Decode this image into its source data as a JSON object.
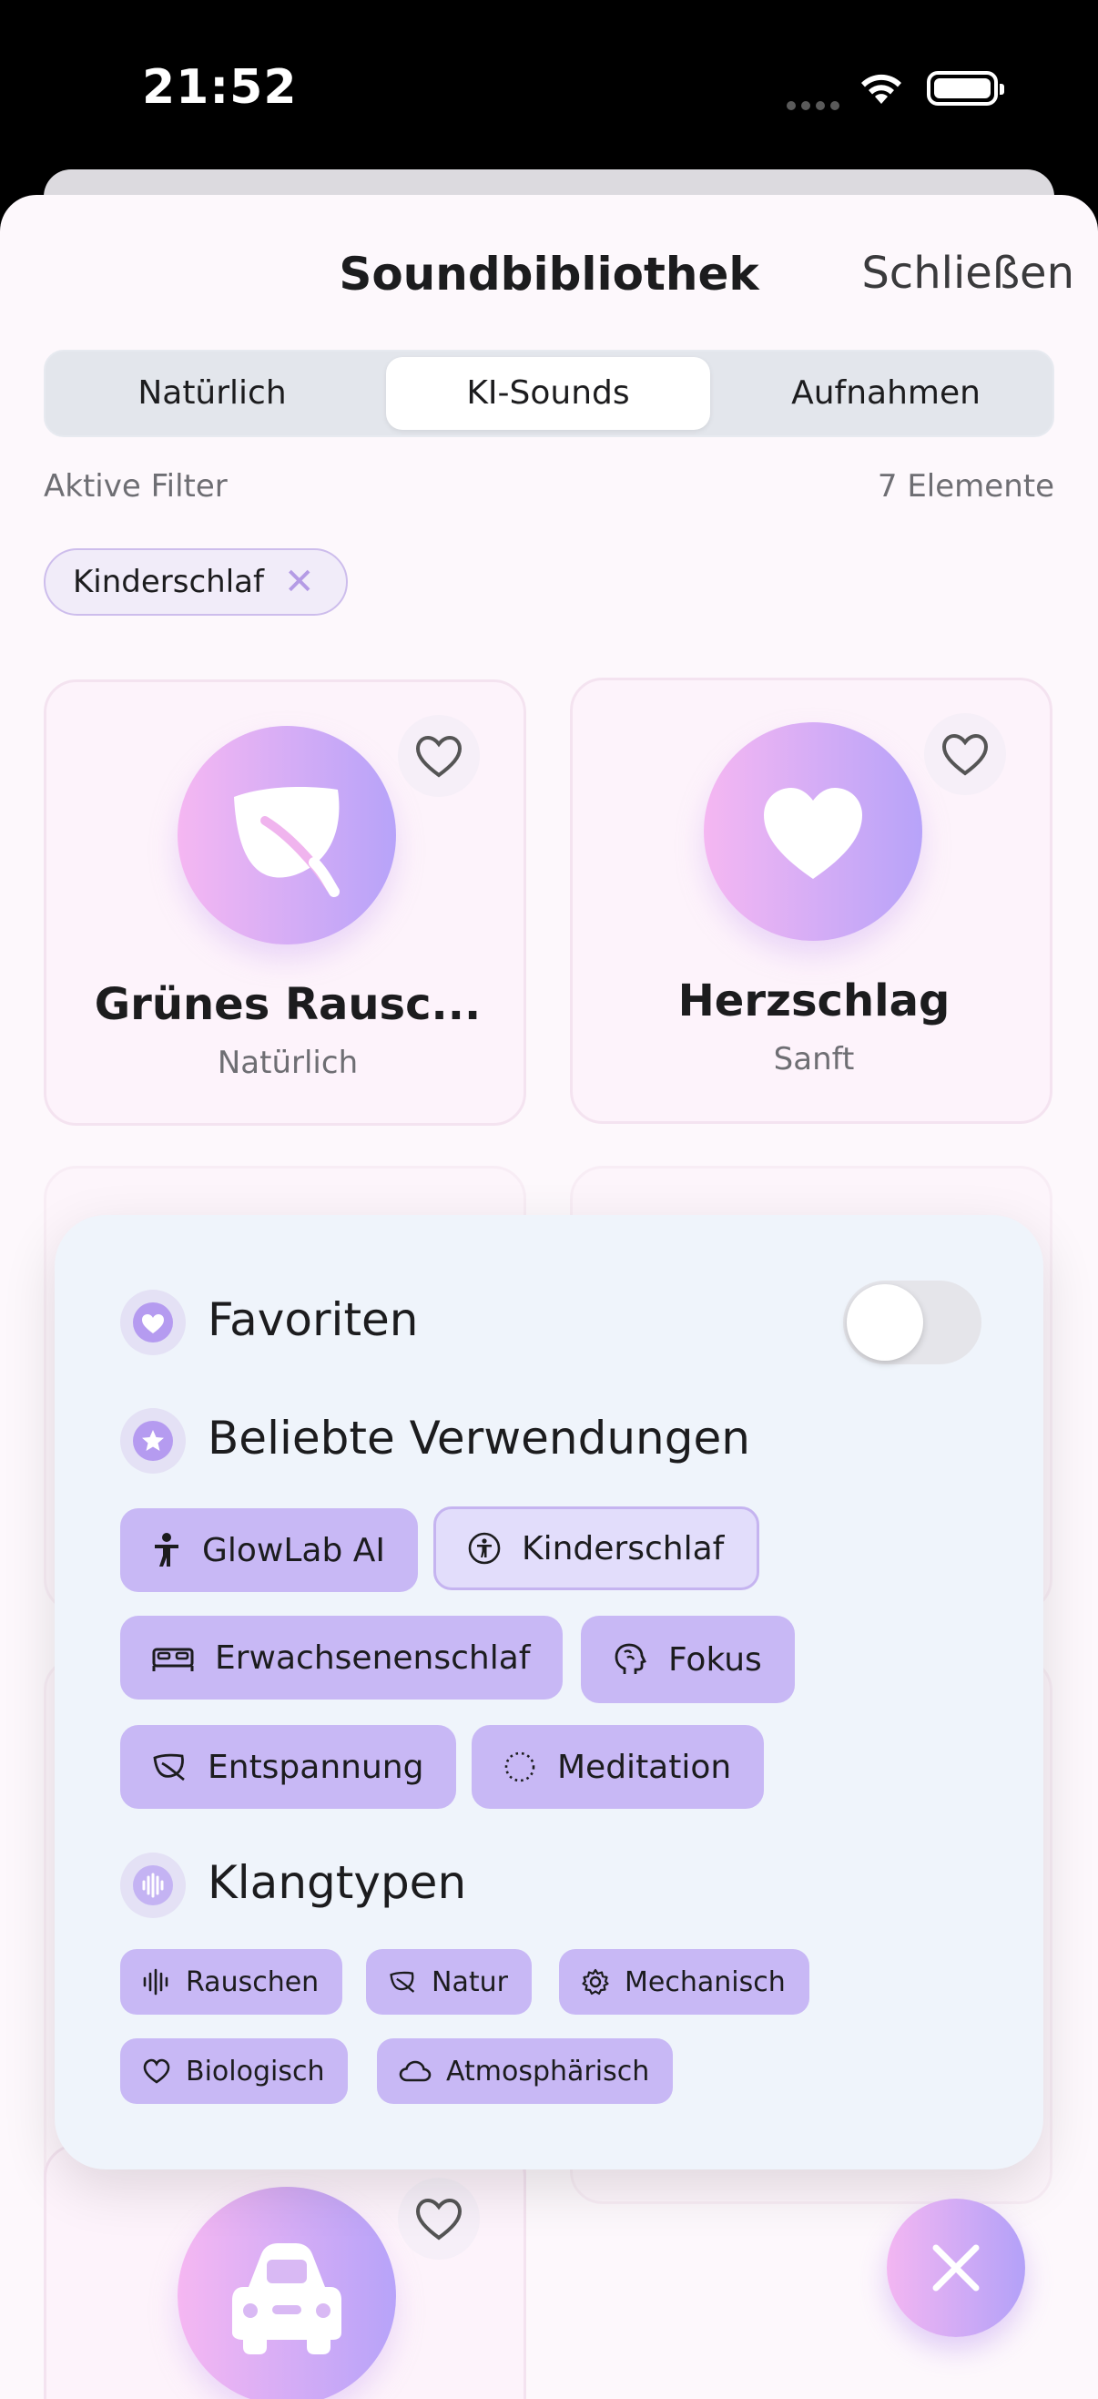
{
  "status_bar": {
    "time": "21:52"
  },
  "header": {
    "title": "Soundbibliothek",
    "close_label": "Schließen"
  },
  "segments": [
    {
      "label": "Natürlich",
      "active": false
    },
    {
      "label": "KI-Sounds",
      "active": true
    },
    {
      "label": "Aufnahmen",
      "active": false
    }
  ],
  "filters": {
    "label": "Aktive Filter",
    "count": "7 Elemente",
    "active_chip": "Kinderschlaf"
  },
  "cards": [
    {
      "title": "Grünes Rausc...",
      "subtitle": "Natürlich",
      "icon": "leaf-icon"
    },
    {
      "title": "Herzschlag",
      "subtitle": "Sanft",
      "icon": "heart-icon"
    },
    {
      "title": "",
      "subtitle": "",
      "icon": "car-icon"
    }
  ],
  "popover": {
    "favorites_label": "Favoriten",
    "favorites_on": false,
    "uses_label": "Beliebte Verwendungen",
    "uses": [
      {
        "label": "GlowLab AI",
        "icon": "person-icon",
        "selected": false
      },
      {
        "label": "Kinderschlaf",
        "icon": "child-icon",
        "selected": true
      },
      {
        "label": "Erwachsenenschlaf",
        "icon": "bed-icon",
        "selected": false
      },
      {
        "label": "Fokus",
        "icon": "brain-icon",
        "selected": false
      },
      {
        "label": "Entspannung",
        "icon": "leaf-icon",
        "selected": false
      },
      {
        "label": "Meditation",
        "icon": "dotted-circle-icon",
        "selected": false
      }
    ],
    "types_label": "Klangtypen",
    "types": [
      {
        "label": "Rauschen",
        "icon": "waveform-icon"
      },
      {
        "label": "Natur",
        "icon": "leaf-icon"
      },
      {
        "label": "Mechanisch",
        "icon": "gear-icon"
      },
      {
        "label": "Biologisch",
        "icon": "heart-icon"
      },
      {
        "label": "Atmosphärisch",
        "icon": "cloud-icon"
      }
    ]
  },
  "colors": {
    "accent_gradient_start": "#f5b7f2",
    "accent_gradient_end": "#b7a3f9",
    "pill": "#c8b8f5",
    "popover_bg": "#eff4fb"
  }
}
